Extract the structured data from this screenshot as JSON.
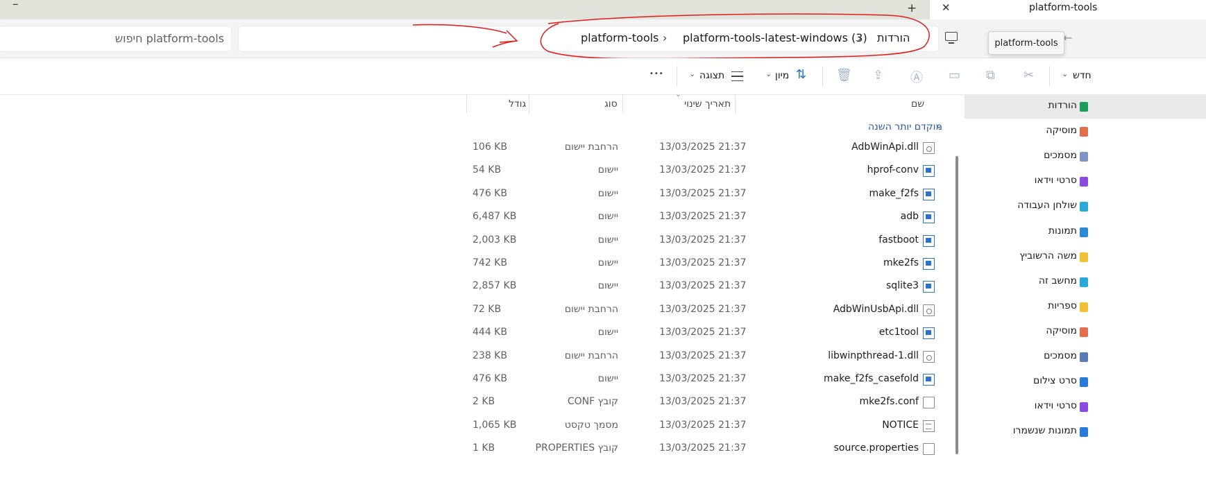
{
  "window": {
    "active_tab_title": "platform-tools",
    "new_tab_symbol": "+",
    "close_symbol": "✕",
    "minimize_symbol": "–"
  },
  "address_bar": {
    "search_placeholder": "חיפוש platform-tools",
    "crumbs": [
      "הורדות",
      "platform-tools-latest-windows (3)",
      "platform-tools"
    ],
    "separator": "›",
    "back_symbol": "←",
    "annotation": {
      "description": "red hand-drawn circle and arrow around breadcrumb",
      "color": "#e01b1b"
    }
  },
  "tooltip": "platform-tools",
  "toolbar": {
    "new_label": "חדש",
    "sort_label": "מיון",
    "view_label": "תצוגה",
    "more_symbol": "•••",
    "chevron": "⌄"
  },
  "columns": {
    "name": "שם",
    "date": "תאריך שינוי",
    "type": "סוג",
    "size": "גודל"
  },
  "group_header": "מוקדם יותר השנה",
  "files": [
    {
      "name": "AdbWinApi.dll",
      "date": "13/03/2025 21:37",
      "type": "הרחבת יישום",
      "size": "106 KB",
      "icon": "dll"
    },
    {
      "name": "hprof-conv",
      "date": "13/03/2025 21:37",
      "type": "יישום",
      "size": "54 KB",
      "icon": "app"
    },
    {
      "name": "make_f2fs",
      "date": "13/03/2025 21:37",
      "type": "יישום",
      "size": "476 KB",
      "icon": "app"
    },
    {
      "name": "adb",
      "date": "13/03/2025 21:37",
      "type": "יישום",
      "size": "6,487 KB",
      "icon": "app"
    },
    {
      "name": "fastboot",
      "date": "13/03/2025 21:37",
      "type": "יישום",
      "size": "2,003 KB",
      "icon": "app"
    },
    {
      "name": "mke2fs",
      "date": "13/03/2025 21:37",
      "type": "יישום",
      "size": "742 KB",
      "icon": "app"
    },
    {
      "name": "sqlite3",
      "date": "13/03/2025 21:37",
      "type": "יישום",
      "size": "2,857 KB",
      "icon": "app"
    },
    {
      "name": "AdbWinUsbApi.dll",
      "date": "13/03/2025 21:37",
      "type": "הרחבת יישום",
      "size": "72 KB",
      "icon": "dll"
    },
    {
      "name": "etc1tool",
      "date": "13/03/2025 21:37",
      "type": "יישום",
      "size": "444 KB",
      "icon": "app"
    },
    {
      "name": "libwinpthread-1.dll",
      "date": "13/03/2025 21:37",
      "type": "הרחבת יישום",
      "size": "238 KB",
      "icon": "dll"
    },
    {
      "name": "make_f2fs_casefold",
      "date": "13/03/2025 21:37",
      "type": "יישום",
      "size": "476 KB",
      "icon": "app"
    },
    {
      "name": "mke2fs.conf",
      "date": "13/03/2025 21:37",
      "type": "קובץ CONF",
      "size": "2 KB",
      "icon": "doc"
    },
    {
      "name": "NOTICE",
      "date": "13/03/2025 21:37",
      "type": "מסמך טקסט",
      "size": "1,065 KB",
      "icon": "txt"
    },
    {
      "name": "source.properties",
      "date": "13/03/2025 21:37",
      "type": "קובץ PROPERTIES",
      "size": "1 KB",
      "icon": "doc"
    }
  ],
  "nav": [
    {
      "label": "הורדות",
      "color": "#1a9e5a",
      "selected": true
    },
    {
      "label": "מוסיקה",
      "color": "#e1704a"
    },
    {
      "label": "מסמכים",
      "color": "#7d96c4"
    },
    {
      "label": "סרטי וידאו",
      "color": "#8a4be0"
    },
    {
      "label": "שולחן העבודה",
      "color": "#2aa8d8"
    },
    {
      "label": "תמונות",
      "color": "#2a8ad8"
    },
    {
      "label": "משה הרשוביץ",
      "color": "#f2c037"
    },
    {
      "label": "מחשב זה",
      "color": "#2aa8d8"
    },
    {
      "label": "ספריות",
      "color": "#f2c037"
    },
    {
      "label": "מוסיקה",
      "color": "#e1704a"
    },
    {
      "label": "מסמכים",
      "color": "#5a7ab8"
    },
    {
      "label": "סרט צילום",
      "color": "#2a7ad8"
    },
    {
      "label": "סרטי וידאו",
      "color": "#8a4be0"
    },
    {
      "label": "תמונות שנשמרו",
      "color": "#2a7ad8"
    }
  ]
}
